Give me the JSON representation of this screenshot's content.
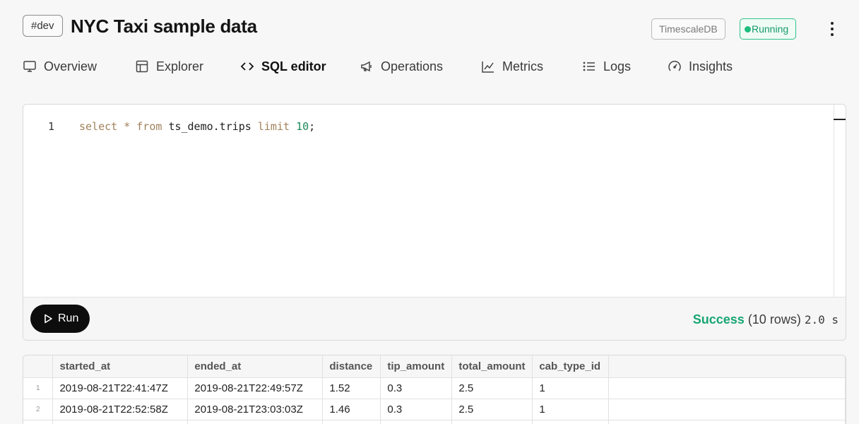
{
  "header": {
    "tag": "#dev",
    "title": "NYC Taxi sample data",
    "db_badge": "TimescaleDB",
    "status": "Running"
  },
  "tabs": [
    {
      "label": "Overview",
      "icon": "monitor-icon"
    },
    {
      "label": "Explorer",
      "icon": "layout-icon"
    },
    {
      "label": "SQL editor",
      "icon": "code-icon",
      "active": true
    },
    {
      "label": "Operations",
      "icon": "megaphone-icon"
    },
    {
      "label": "Metrics",
      "icon": "line-chart-icon"
    },
    {
      "label": "Logs",
      "icon": "list-icon"
    },
    {
      "label": "Insights",
      "icon": "gauge-icon"
    }
  ],
  "editor": {
    "line_number": "1",
    "code": {
      "kw1": "select",
      "star": "*",
      "kw2": "from",
      "table": "ts_demo.trips",
      "kw3": "limit",
      "num": "10",
      "end": ";"
    },
    "run_label": "Run",
    "result_status": "Success",
    "row_count": "(10 rows)",
    "duration": "2.0 s"
  },
  "results": {
    "columns": [
      "started_at",
      "ended_at",
      "distance",
      "tip_amount",
      "total_amount",
      "cab_type_id"
    ],
    "rows": [
      {
        "n": "1",
        "cells": [
          "2019-08-21T22:41:47Z",
          "2019-08-21T22:49:57Z",
          "1.52",
          "0.3",
          "2.5",
          "1"
        ]
      },
      {
        "n": "2",
        "cells": [
          "2019-08-21T22:52:58Z",
          "2019-08-21T23:03:03Z",
          "1.46",
          "0.3",
          "2.5",
          "1"
        ]
      }
    ]
  },
  "colors": {
    "accent_success": "#17a673",
    "status_green": "#1dbd7e",
    "run_button": "#0d0d0d",
    "keyword": "#a1815a",
    "number": "#1b8a5a"
  }
}
